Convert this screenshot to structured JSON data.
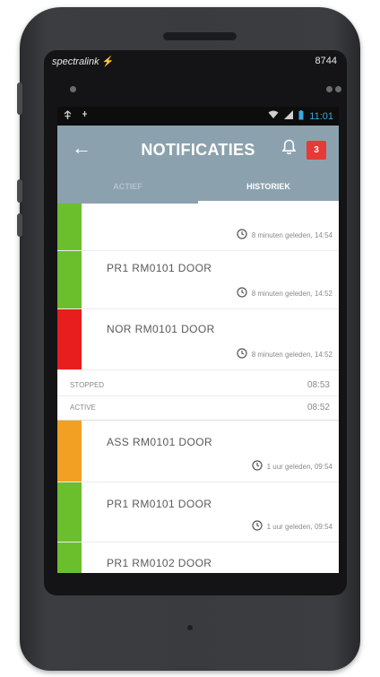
{
  "device": {
    "brand": "spectralink",
    "extension": "8744"
  },
  "statusbar": {
    "time": "11:01"
  },
  "header": {
    "title": "NOTIFICATIES",
    "badge_count": "3",
    "back_icon": "arrow-left-icon",
    "bell_icon": "bell-icon"
  },
  "tabs": [
    {
      "label": "ACTIEF",
      "active": false
    },
    {
      "label": "HISTORIEK",
      "active": true
    }
  ],
  "items": [
    {
      "title": "",
      "time": "8 minuten geleden, 14:54",
      "color": "#6cbf2c"
    },
    {
      "title": "PR1 RM0101 DOOR",
      "time": "8 minuten geleden, 14:52",
      "color": "#6cbf2c"
    },
    {
      "title": "NOR RM0101 DOOR",
      "time": "8 minuten geleden, 14:52",
      "color": "#e81d1d"
    }
  ],
  "status_rows": [
    {
      "label": "STOPPED",
      "value": "08:53"
    },
    {
      "label": "ACTIVE",
      "value": "08:52"
    }
  ],
  "items2": [
    {
      "title": "ASS RM0101 DOOR",
      "time": "1 uur geleden, 09:54",
      "color": "#f2a023"
    },
    {
      "title": "PR1 RM0101 DOOR",
      "time": "1 uur geleden, 09:54",
      "color": "#6cbf2c"
    },
    {
      "title": "PR1 RM0102 DOOR",
      "time": "",
      "color": "#6cbf2c"
    }
  ]
}
